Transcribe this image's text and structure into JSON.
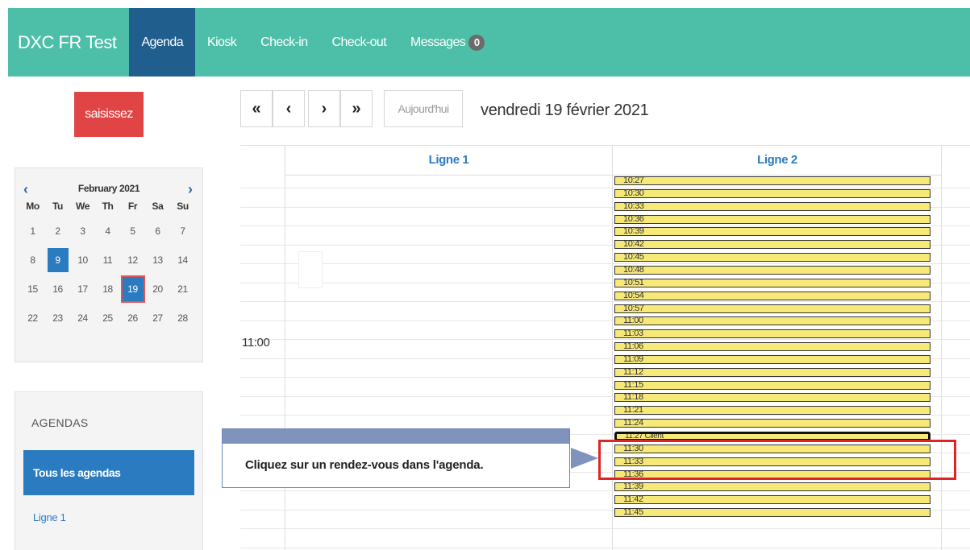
{
  "nav": {
    "brand": "DXC FR Test",
    "items": [
      {
        "label": "Agenda"
      },
      {
        "label": "Kiosk"
      },
      {
        "label": "Check-in"
      },
      {
        "label": "Check-out"
      },
      {
        "label": "Messages"
      }
    ],
    "messages_badge": "0",
    "colors": {
      "bar": "#4dbfa8",
      "active": "#1f5e8d"
    }
  },
  "sidebar": {
    "primary_button": "saisissez",
    "calendar": {
      "title": "February 2021",
      "prev_icon": "chevron-left-icon",
      "next_icon": "chevron-right-icon",
      "weekdays": [
        "Mo",
        "Tu",
        "We",
        "Th",
        "Fr",
        "Sa",
        "Su"
      ],
      "weeks": [
        [
          "1",
          "2",
          "3",
          "4",
          "5",
          "6",
          "7"
        ],
        [
          "8",
          "9",
          "10",
          "11",
          "12",
          "13",
          "14"
        ],
        [
          "15",
          "16",
          "17",
          "18",
          "19",
          "20",
          "21"
        ],
        [
          "22",
          "23",
          "24",
          "25",
          "26",
          "27",
          "28"
        ]
      ],
      "selected_day": "9",
      "current_day": "19"
    },
    "agendas": {
      "title": "AGENDAS",
      "all_label": "Tous les agendas",
      "items": [
        "Ligne 1"
      ]
    }
  },
  "toolbar": {
    "first": "«",
    "prev": "‹",
    "next": "›",
    "last": "»",
    "today": "Aujourd'hui",
    "date": "vendredi 19 février 2021"
  },
  "agenda": {
    "columns": [
      "Ligne 1",
      "Ligne 2"
    ],
    "time_label": "11:00",
    "slots": [
      "10:27",
      "10:30",
      "10:33",
      "10:36",
      "10:39",
      "10:42",
      "10:45",
      "10:48",
      "10:51",
      "10:54",
      "10:57",
      "11:00",
      "11:03",
      "11:06",
      "11:09",
      "11:12",
      "11:15",
      "11:18",
      "11:21",
      "11:24",
      "11:27 Client",
      "11:30",
      "11:33",
      "11:36",
      "11:39",
      "11:42",
      "11:45"
    ],
    "booked_index": 20,
    "slot_color": "#f7e978"
  },
  "tooltip": {
    "text": "Cliquez sur un rendez-vous dans l'agenda."
  }
}
